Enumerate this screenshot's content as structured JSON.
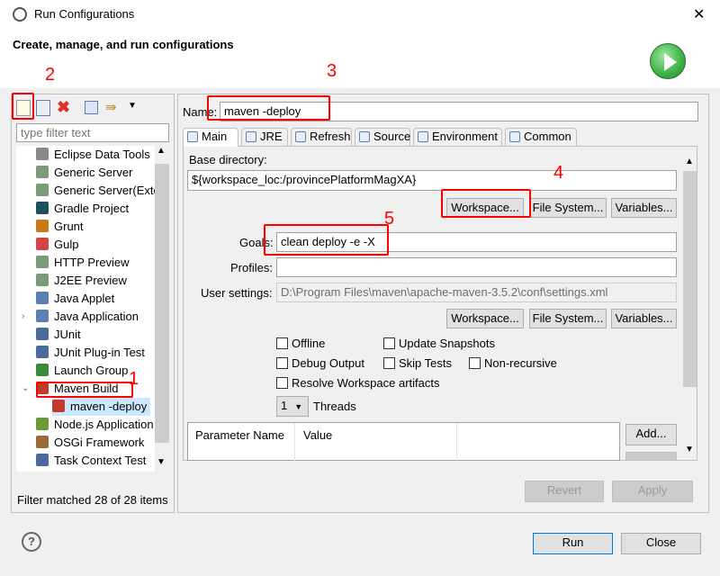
{
  "window": {
    "title": "Run Configurations",
    "close": "✕"
  },
  "header": {
    "subtitle": "Create, manage, and run configurations"
  },
  "sidebar": {
    "filter_placeholder": "type filter text",
    "items": [
      {
        "label": "Eclipse Data Tools",
        "icon": "database-icon",
        "color": "#888888"
      },
      {
        "label": "Generic Server",
        "icon": "server-icon",
        "color": "#7a9a7a"
      },
      {
        "label": "Generic Server(Exte",
        "icon": "server-icon",
        "color": "#7a9a7a"
      },
      {
        "label": "Gradle Project",
        "icon": "gradle-icon",
        "color": "#1f4f5f"
      },
      {
        "label": "Grunt",
        "icon": "grunt-icon",
        "color": "#c97a1a"
      },
      {
        "label": "Gulp",
        "icon": "gulp-icon",
        "color": "#cf4647"
      },
      {
        "label": "HTTP Preview",
        "icon": "server-icon",
        "color": "#7a9a7a"
      },
      {
        "label": "J2EE Preview",
        "icon": "server-icon",
        "color": "#7a9a7a"
      },
      {
        "label": "Java Applet",
        "icon": "applet-icon",
        "color": "#5a7fb0"
      },
      {
        "label": "Java Application",
        "icon": "java-app-icon",
        "color": "#5a7fb0",
        "expandable": true
      },
      {
        "label": "JUnit",
        "icon": "junit-icon",
        "color": "#4a6a9a"
      },
      {
        "label": "JUnit Plug-in Test",
        "icon": "junit-icon",
        "color": "#4a6a9a"
      },
      {
        "label": "Launch Group",
        "icon": "launch-group-icon",
        "color": "#3a8a3a"
      },
      {
        "label": "Maven Build",
        "icon": "maven-icon",
        "color": "#c0392b",
        "expanded": true
      },
      {
        "label": "maven -deploy",
        "icon": "maven-icon",
        "color": "#c0392b",
        "child": true,
        "selected": true
      },
      {
        "label": "Node.js Application",
        "icon": "nodejs-icon",
        "color": "#6a9a3a"
      },
      {
        "label": "OSGi Framework",
        "icon": "osgi-icon",
        "color": "#9a6a3a"
      },
      {
        "label": "Task Context Test",
        "icon": "junit-icon",
        "color": "#4a6a9a"
      }
    ],
    "status": "Filter matched 28 of 28 items"
  },
  "form": {
    "name_label": "Name:",
    "name_value": "maven -deploy",
    "tabs": [
      "Main",
      "JRE",
      "Refresh",
      "Source",
      "Environment",
      "Common"
    ],
    "base_dir_label": "Base directory:",
    "base_dir_value": "${workspace_loc:/provincePlatformMagXA}",
    "workspace_btn": "Workspace...",
    "filesystem_btn": "File System...",
    "variables_btn": "Variables...",
    "goals_label": "Goals:",
    "goals_value": "clean deploy -e -X",
    "profiles_label": "Profiles:",
    "profiles_value": "",
    "user_settings_label": "User settings:",
    "user_settings_value": "D:\\Program Files\\maven\\apache-maven-3.5.2\\conf\\settings.xml",
    "checkboxes": {
      "offline": "Offline",
      "update_snapshots": "Update Snapshots",
      "debug_output": "Debug Output",
      "skip_tests": "Skip Tests",
      "non_recursive": "Non-recursive",
      "resolve_workspace": "Resolve Workspace artifacts"
    },
    "threads_value": "1",
    "threads_label": "Threads",
    "table_headers": [
      "Parameter Name",
      "Value"
    ],
    "add_btn": "Add...",
    "revert_btn": "Revert",
    "apply_btn": "Apply"
  },
  "footer": {
    "run_btn": "Run",
    "close_btn": "Close",
    "help": "?"
  },
  "annotations": [
    "1",
    "2",
    "3",
    "4",
    "5"
  ],
  "colors": {
    "annotation": "#ff0000",
    "selected": "#cce8ff",
    "run_icon": "#3cb043"
  }
}
